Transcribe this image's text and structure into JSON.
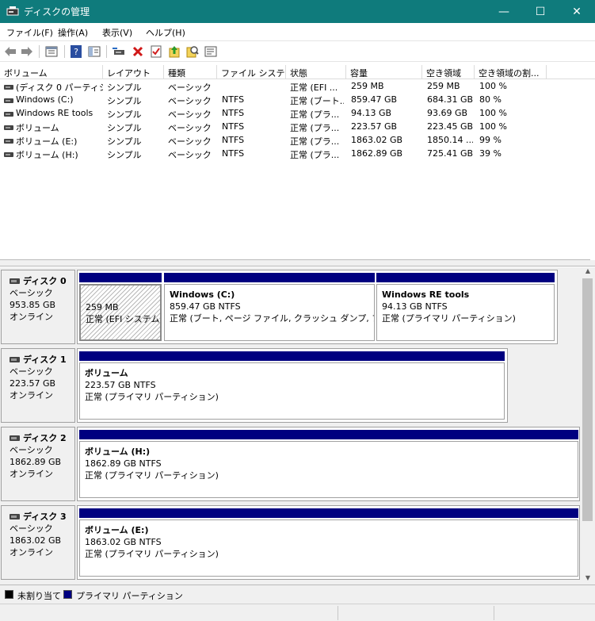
{
  "window": {
    "title": "ディスクの管理",
    "min_glyph": "—",
    "max_glyph": "☐",
    "close_glyph": "✕"
  },
  "menu": [
    "ファイル(F)",
    "操作(A)",
    "表示(V)",
    "ヘルプ(H)"
  ],
  "toolbar": {
    "icons": [
      "back-icon",
      "forward-icon",
      "properties-view-icon",
      "help-icon",
      "show-hide-console-tree-icon",
      "connect-drive-icon",
      "delete-icon",
      "check-properties-icon",
      "import-icon",
      "search-icon",
      "new-window-icon"
    ]
  },
  "volume_list": {
    "columns": [
      "ボリューム",
      "レイアウト",
      "種類",
      "ファイル システム",
      "状態",
      "容量",
      "空き領域",
      "空き領域の割..."
    ],
    "rows": [
      [
        "(ディスク 0 パーティシ...",
        "シンプル",
        "ベーシック",
        "",
        "正常 (EFI ...",
        "259 MB",
        "259 MB",
        "100 %"
      ],
      [
        "Windows (C:)",
        "シンプル",
        "ベーシック",
        "NTFS",
        "正常 (ブート...",
        "859.47 GB",
        "684.31 GB",
        "80 %"
      ],
      [
        "Windows RE tools",
        "シンプル",
        "ベーシック",
        "NTFS",
        "正常 (プラ...",
        "94.13 GB",
        "93.69 GB",
        "100 %"
      ],
      [
        "ボリューム",
        "シンプル",
        "ベーシック",
        "NTFS",
        "正常 (プラ...",
        "223.57 GB",
        "223.45 GB",
        "100 %"
      ],
      [
        "ボリューム (E:)",
        "シンプル",
        "ベーシック",
        "NTFS",
        "正常 (プラ...",
        "1863.02 GB",
        "1850.14 ...",
        "99 %"
      ],
      [
        "ボリューム (H:)",
        "シンプル",
        "ベーシック",
        "NTFS",
        "正常 (プラ...",
        "1862.89 GB",
        "725.41 GB",
        "39 %"
      ]
    ]
  },
  "disks": [
    {
      "name": "ディスク 0",
      "type": "ベーシック",
      "size": "953.85 GB",
      "status": "オンライン",
      "partitions": [
        {
          "name": "",
          "size": "259 MB",
          "status": "正常 (EFI システム パ"
        },
        {
          "name": "Windows  (C:)",
          "size": "859.47 GB NTFS",
          "status": "正常 (ブート, ページ ファイル, クラッシュ ダンプ, プライマリ"
        },
        {
          "name": "Windows RE tools",
          "size": "94.13 GB NTFS",
          "status": "正常 (プライマリ パーティション)"
        }
      ]
    },
    {
      "name": "ディスク 1",
      "type": "ベーシック",
      "size": "223.57 GB",
      "status": "オンライン",
      "partitions": [
        {
          "name": "ボリューム",
          "size": "223.57 GB NTFS",
          "status": "正常 (プライマリ パーティション)"
        }
      ]
    },
    {
      "name": "ディスク 2",
      "type": "ベーシック",
      "size": "1862.89 GB",
      "status": "オンライン",
      "partitions": [
        {
          "name": "ボリューム  (H:)",
          "size": "1862.89 GB NTFS",
          "status": "正常 (プライマリ パーティション)"
        }
      ]
    },
    {
      "name": "ディスク 3",
      "type": "ベーシック",
      "size": "1863.02 GB",
      "status": "オンライン",
      "partitions": [
        {
          "name": "ボリューム  (E:)",
          "size": "1863.02 GB NTFS",
          "status": "正常 (プライマリ パーティション)"
        }
      ]
    }
  ],
  "legend": [
    {
      "label": "未割り当て",
      "color": "#000000"
    },
    {
      "label": "プライマリ パーティション",
      "color": "#000080"
    }
  ],
  "colors": {
    "titlebar": "#0f7b7c",
    "primary_partition": "#000080"
  }
}
